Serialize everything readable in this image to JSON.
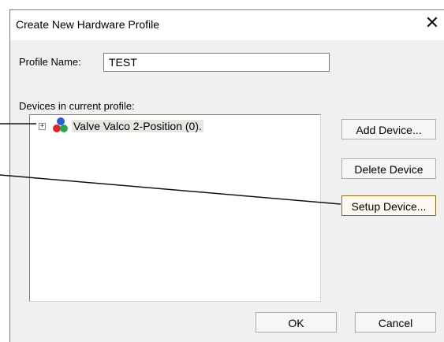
{
  "window": {
    "title": "Create New Hardware Profile",
    "close_glyph": "✕"
  },
  "profile": {
    "label": "Profile Name:",
    "value": "TEST"
  },
  "devices": {
    "label": "Devices in current profile:",
    "items": [
      {
        "label": "Valve Valco 2-Position (0).",
        "icon": "device-cluster-icon",
        "expanded": false
      }
    ]
  },
  "buttons": {
    "add": "Add Device...",
    "delete": "Delete Device",
    "setup": "Setup Device...",
    "ok": "OK",
    "cancel": "Cancel"
  },
  "colors": {
    "dialog_bg": "#f0f0f0",
    "highlight": "#e8e6e0",
    "focus_border": "#8a6d1f"
  }
}
